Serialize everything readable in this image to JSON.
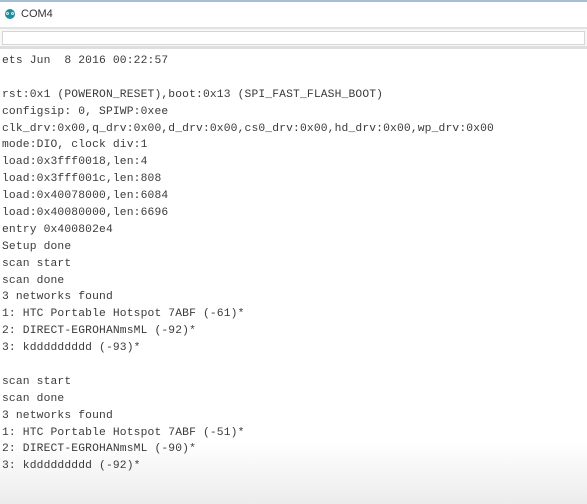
{
  "window": {
    "title": "COM4",
    "icon": "arduino-icon"
  },
  "send_input": {
    "value": "",
    "placeholder": ""
  },
  "serial_output": {
    "lines": [
      "ets Jun  8 2016 00:22:57",
      "",
      "rst:0x1 (POWERON_RESET),boot:0x13 (SPI_FAST_FLASH_BOOT)",
      "configsip: 0, SPIWP:0xee",
      "clk_drv:0x00,q_drv:0x00,d_drv:0x00,cs0_drv:0x00,hd_drv:0x00,wp_drv:0x00",
      "mode:DIO, clock div:1",
      "load:0x3fff0018,len:4",
      "load:0x3fff001c,len:808",
      "load:0x40078000,len:6084",
      "load:0x40080000,len:6696",
      "entry 0x400802e4",
      "Setup done",
      "scan start",
      "scan done",
      "3 networks found",
      "1: HTC Portable Hotspot 7ABF (-61)*",
      "2: DIRECT-EGROHANmsML (-92)*",
      "3: kddddddddd (-93)*",
      "",
      "scan start",
      "scan done",
      "3 networks found",
      "1: HTC Portable Hotspot 7ABF (-51)*",
      "2: DIRECT-EGROHANmsML (-90)*",
      "3: kddddddddd (-92)*"
    ]
  }
}
